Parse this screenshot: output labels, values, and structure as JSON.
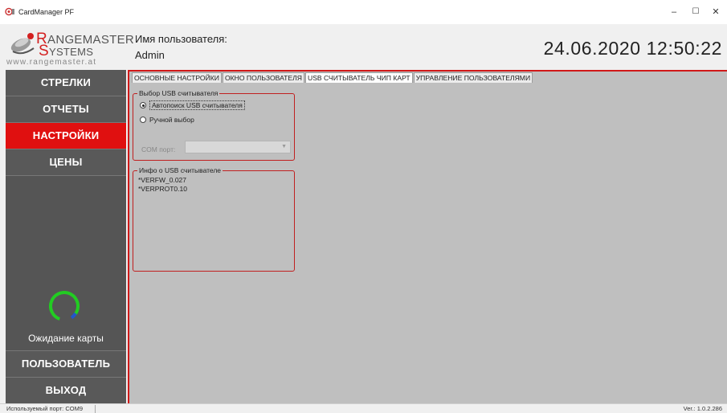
{
  "window": {
    "title": "CardManager PF",
    "minimize_glyph": "–",
    "maximize_glyph": "☐",
    "close_glyph": "✕"
  },
  "header": {
    "logo": {
      "line1_initial": "R",
      "line1_rest": "ANGEMASTER",
      "line2_initial": "S",
      "line2_rest": "YSTEMS",
      "url": "www.rangemaster.at"
    },
    "user_label": "Имя пользователя:",
    "user_name": "Admin",
    "datetime": "24.06.2020 12:50:22"
  },
  "sidebar": {
    "items": [
      {
        "label": "СТРЕЛКИ",
        "active": false
      },
      {
        "label": "ОТЧЕТЫ",
        "active": false
      },
      {
        "label": "НАСТРОЙКИ",
        "active": true
      },
      {
        "label": "ЦЕНЫ",
        "active": false
      }
    ],
    "wait_label": "Ожидание карты",
    "bottom_items": [
      {
        "label": "ПОЛЬЗОВАТЕЛЬ"
      },
      {
        "label": "ВЫХОД"
      }
    ]
  },
  "tabs": [
    {
      "label": "ОСНОВНЫЕ НАСТРОЙКИ",
      "active": false
    },
    {
      "label": "ОКНО ПОЛЬЗОВАТЕЛЯ",
      "active": false
    },
    {
      "label": "USB СЧИТЫВАТЕЛЬ ЧИП КАРТ",
      "active": true
    },
    {
      "label": "УПРАВЛЕНИЕ ПОЛЬЗОВАТЕЛЯМИ",
      "active": false
    }
  ],
  "usb_select": {
    "legend": "Выбор USB считывателя",
    "auto_option": "Автопоиск USB считывателя",
    "manual_option": "Ручной выбор",
    "selected": "auto",
    "com_label": "COM порт:",
    "com_value": ""
  },
  "usb_info": {
    "legend": "Инфо о USB считывателе",
    "lines": [
      "*VERFW_0.027",
      "*VERPROT0.10"
    ]
  },
  "statusbar": {
    "port": "Используемый порт: COM9",
    "version": "Ver.: 1.0.2.286"
  },
  "colors": {
    "accent_red": "#e01010",
    "sidebar_gray": "#595959",
    "content_bg": "#bfbfbf",
    "spinner_green": "#22cc22",
    "spinner_blue": "#2255cc"
  },
  "icons": {
    "app": "target-icon",
    "spinner": "loading-spinner-icon"
  }
}
